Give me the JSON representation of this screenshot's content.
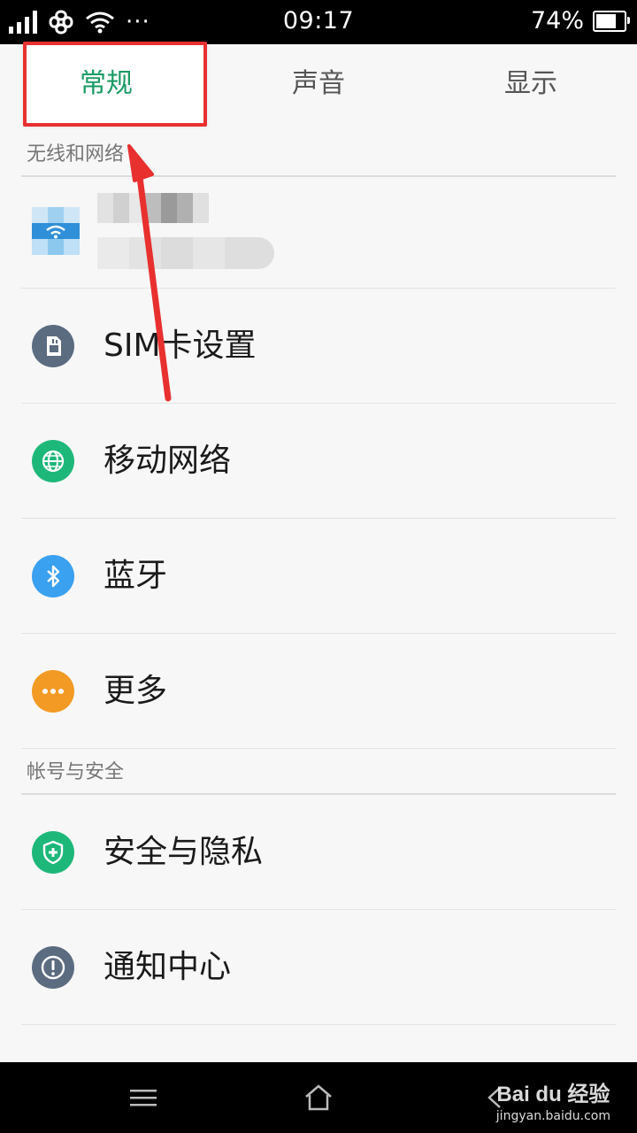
{
  "status_bar": {
    "time": "09:17",
    "battery_percent": "74%",
    "battery_level": 0.74,
    "overflow_glyph": "···"
  },
  "tabs": [
    {
      "label": "常规",
      "active": true
    },
    {
      "label": "声音",
      "active": false
    },
    {
      "label": "显示",
      "active": false
    }
  ],
  "sections": [
    {
      "title": "无线和网络"
    },
    {
      "title": "帐号与安全"
    }
  ],
  "items": [
    {
      "label": "SIM卡设置",
      "icon": "sim-card-icon",
      "icon_color": "#5b6b80"
    },
    {
      "label": "移动网络",
      "icon": "globe-icon",
      "icon_color": "#1eb77a"
    },
    {
      "label": "蓝牙",
      "icon": "bluetooth-icon",
      "icon_color": "#3aa0f0"
    },
    {
      "label": "更多",
      "icon": "more-icon",
      "icon_color": "#f29a24"
    },
    {
      "label": "安全与隐私",
      "icon": "shield-icon",
      "icon_color": "#1eb77a"
    },
    {
      "label": "通知中心",
      "icon": "exclamation-icon",
      "icon_color": "#5b6b80"
    }
  ],
  "watermark": {
    "brand": "Bai du 经验",
    "url": "jingyan.baidu.com"
  },
  "colors": {
    "accent_green": "#1a9b63",
    "annotation_red": "#e8302f"
  }
}
